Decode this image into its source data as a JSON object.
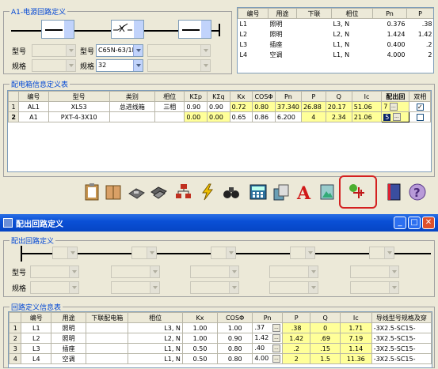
{
  "top": {
    "circuit_def_title": "A1-电源回路定义",
    "xinghao_label": "型号",
    "guige_label": "规格",
    "xinghao_label2": "型号",
    "guige_label2": "规格",
    "breaker_model": "C65N-63/1I",
    "breaker_spec": "32",
    "circuit_list": {
      "headers": [
        "编号",
        "用途",
        "下联",
        "相位",
        "Pn",
        "P"
      ],
      "rows": [
        [
          "L1",
          "照明",
          "",
          "L3, N",
          "0.376",
          ".38"
        ],
        [
          "L2",
          "照明",
          "",
          "L2, N",
          "1.424",
          "1.42"
        ],
        [
          "L3",
          "插座",
          "",
          "L1, N",
          "0.400",
          ".2"
        ],
        [
          "L4",
          "空调",
          "",
          "L1, N",
          "4.000",
          "2"
        ]
      ]
    }
  },
  "box_info": {
    "title": "配电箱信息定义表",
    "headers": [
      "编号",
      "型号",
      "类别",
      "相位",
      "KΣp",
      "KΣq",
      "Kx",
      "COSΦ",
      "Pn",
      "P",
      "Q",
      "Ic",
      "配出回",
      "双相"
    ],
    "rows": [
      {
        "no": "1",
        "id": "AL1",
        "model": "XL53",
        "type": "总进线箱",
        "phase": "三相",
        "ksp": "0.90",
        "ksq": "0.90",
        "kx": "0.72",
        "cos": "0.80",
        "pn": "37.340",
        "p": "26.88",
        "q": "20.17",
        "ic": "51.06",
        "out": "7",
        "checked": true
      },
      {
        "no": "2",
        "id": "A1",
        "model": "PXT-4-3X10",
        "type": "",
        "phase": "",
        "ksp": "0.00",
        "ksq": "0.00",
        "kx": "0.65",
        "cos": "0.86",
        "pn": "6.200",
        "p": "4",
        "q": "2.34",
        "ic": "21.06",
        "out": "5",
        "checked": false
      }
    ]
  },
  "toolbar": {
    "icons": [
      "clipboard-icon",
      "book-icon",
      "disk-icon",
      "save-as-icon",
      "hierarchy-icon",
      "lightning-icon",
      "binoculars-icon",
      "tools-icon",
      "calculator-icon",
      "export-icon",
      "text-a-icon",
      "image-icon",
      "circuit-out-icon",
      "manual-icon",
      "help-icon"
    ]
  },
  "dialog": {
    "title": "配出回路定义",
    "outgoing_title": "配出回路定义",
    "xinghao_label": "型号",
    "guige_label": "规格",
    "info_title": "回路定义信息表",
    "headers": [
      "编号",
      "用途",
      "下联配电箱",
      "相位",
      "Kx",
      "COSΦ",
      "Pn",
      "P",
      "Q",
      "Ic",
      "导线型号规格及穿"
    ],
    "rows": [
      [
        "1",
        "L1",
        "照明",
        "",
        "L3, N",
        "1.00",
        "1.00",
        ".37",
        ".38",
        "0",
        "1.71",
        "-3X2.5-SC15-"
      ],
      [
        "2",
        "L2",
        "照明",
        "",
        "L2, N",
        "1.00",
        "0.90",
        "1.42",
        "1.42",
        ".69",
        "7.19",
        "-3X2.5-SC15-"
      ],
      [
        "3",
        "L3",
        "插座",
        "",
        "L1, N",
        "0.50",
        "0.80",
        ".40",
        ".2",
        ".15",
        "1.14",
        "-3X2.5-SC15-"
      ],
      [
        "4",
        "L4",
        "空调",
        "",
        "L1, N",
        "0.50",
        "0.80",
        "4.00",
        "2",
        "1.5",
        "11.36",
        "-3X2.5-SC15-"
      ]
    ]
  }
}
